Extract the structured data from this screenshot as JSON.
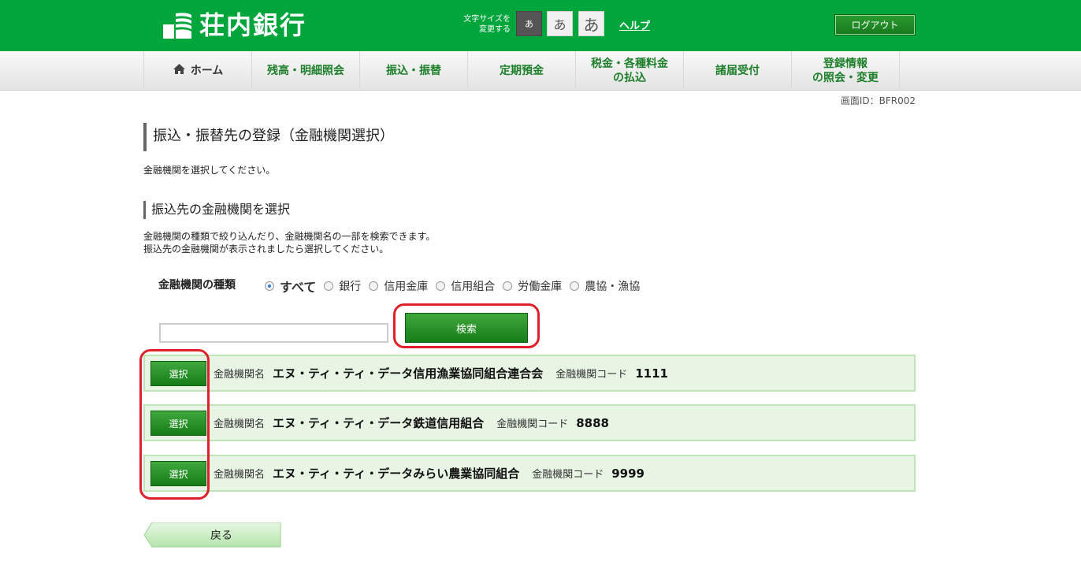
{
  "header": {
    "bank_name": "荘内銀行",
    "font_size_label_line1": "文字サイズを",
    "font_size_label_line2": "変更する",
    "font_size_small": "あ",
    "font_size_medium": "あ",
    "font_size_large": "あ",
    "help": "ヘルプ",
    "logout": "ログアウト",
    "brand_color": "#00a53c"
  },
  "nav": {
    "items": [
      {
        "label": "ホーム",
        "icon": "home-icon"
      },
      {
        "label": "残高・明細照会"
      },
      {
        "label": "振込・振替"
      },
      {
        "label": "定期預金"
      },
      {
        "label_line1": "税金・各種料金",
        "label_line2": "の払込"
      },
      {
        "label": "諸届受付"
      },
      {
        "label_line1": "登録情報",
        "label_line2": "の照会・変更"
      }
    ]
  },
  "screen_id": "画面ID：BFR002",
  "page": {
    "title": "振込・振替先の登録（金融機関選択）",
    "intro": "金融機関を選択してください。",
    "section_title": "振込先の金融機関を選択",
    "desc_line1": "金融機関の種類で絞り込んだり、金融機関名の一部を検索できます。",
    "desc_line2": "振込先の金融機関が表示されましたら選択してください。"
  },
  "filter": {
    "label": "金融機関の種類",
    "options": [
      "すべて",
      "銀行",
      "信用金庫",
      "信用組合",
      "労働金庫",
      "農協・漁協"
    ],
    "selected": "すべて"
  },
  "search": {
    "value": "",
    "button": "検索"
  },
  "results": [
    {
      "select": "選択",
      "name_label": "金融機関名",
      "name": "エヌ・ティ・ティ・データ信用漁業協同組合連合会",
      "code_label": "金融機関コード",
      "code": "1111"
    },
    {
      "select": "選択",
      "name_label": "金融機関名",
      "name": "エヌ・ティ・ティ・データ鉄道信用組合",
      "code_label": "金融機関コード",
      "code": "8888"
    },
    {
      "select": "選択",
      "name_label": "金融機関名",
      "name": "エヌ・ティ・ティ・データみらい農業協同組合",
      "code_label": "金融機関コード",
      "code": "9999"
    }
  ],
  "back": "戻る",
  "annotation_color": "#e0202a"
}
